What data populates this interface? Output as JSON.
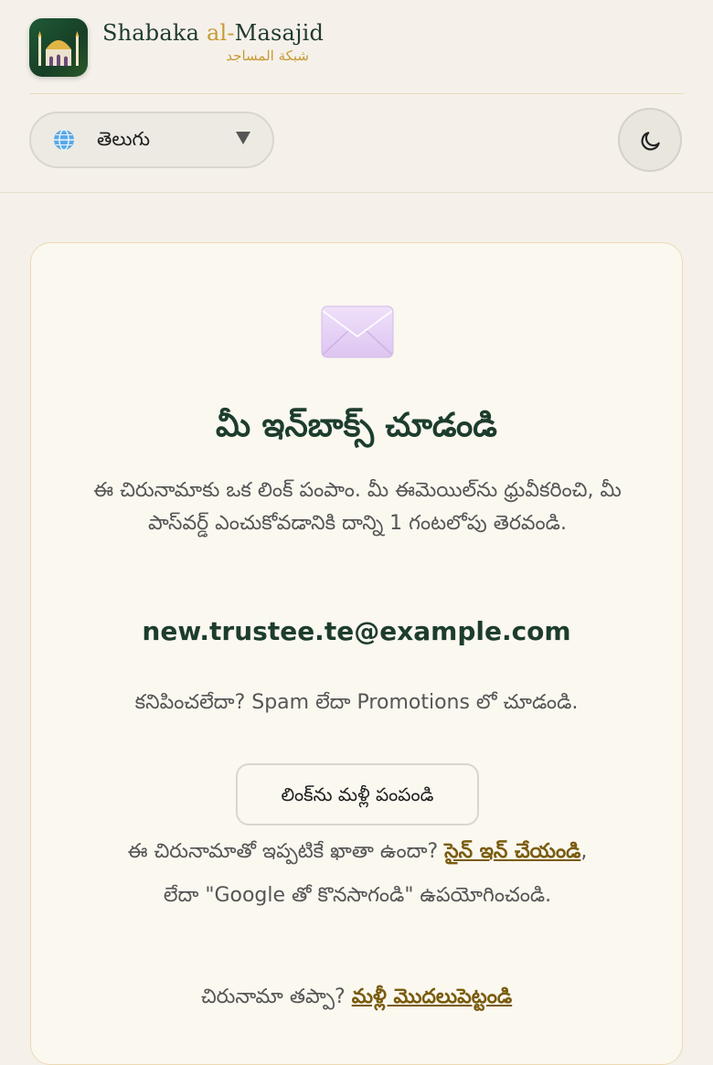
{
  "brand": {
    "name_prefix": "Shabaka ",
    "name_accent": "al-",
    "name_suffix": "Masajid",
    "arabic_name": "شبكة المساجد"
  },
  "toolbar": {
    "language": "తెలుగు"
  },
  "card": {
    "title": "మీ ఇన్‌బాక్స్ చూడండి",
    "description": "ఈ చిరునామాకు ఒక లింక్ పంపాం. మీ ఈమెయిల్‌ను ధ్రువీకరించి, మీ పాస్‌వర్డ్ ఎంచుకోవడానికి దాన్ని 1 గంటలోపు తెరవండి.",
    "email": "new.trustee.te@example.com",
    "hint": "కనిపించలేదా? Spam లేదా Promotions లో చూడండి.",
    "resend_label": "లింక్‌ను మళ్లీ పంపండి",
    "signin_prefix": "ఈ చిరునామాతో ఇప్పటికే ఖాతా ఉందా? ",
    "signin_link": "సైన్ ఇన్ చేయండి",
    "signin_suffix": ", లేదా \"Google తో కొనసాగండి\" ఉపయోగించండి.",
    "restart_prefix": "చిరునామా తప్పా? ",
    "restart_link": "మళ్లీ మొదలుపెట్టండి"
  },
  "colors": {
    "brand_green": "#1d3d2c",
    "accent_gold": "#c89a36",
    "link": "#7a5c0f",
    "background": "#f5f1ea"
  },
  "icons": [
    "mosque-icon",
    "globe-icon",
    "chevron-down-icon",
    "moon-icon",
    "envelope-icon"
  ]
}
